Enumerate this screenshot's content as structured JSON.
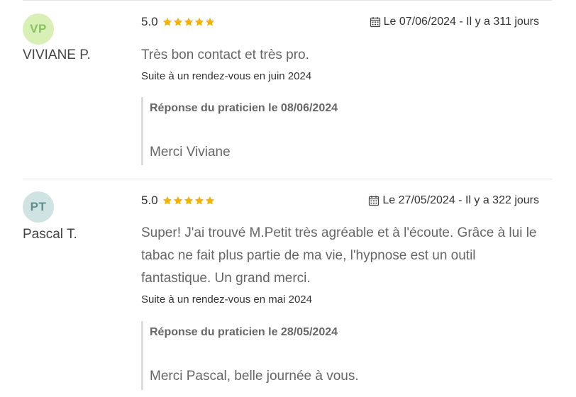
{
  "colors": {
    "star": "#f5b301",
    "avatar_vp_bg": "#d8f0b5",
    "avatar_vp_text": "#8cc063",
    "avatar_pt_bg": "#cfe3e3",
    "avatar_pt_text": "#5f8f8f"
  },
  "icons": {
    "star": "star-icon",
    "calendar": "calendar-icon"
  },
  "reviews": [
    {
      "initials": "VP",
      "author": "VIVIANE P.",
      "rating_value": "5.0",
      "stars": 5,
      "date": "Le 07/06/2024 - Il y a 311 jours",
      "comment": "Très bon contact et très pro.",
      "visit": "Suite à un rendez-vous en juin 2024",
      "response_title": "Réponse du praticien le 08/06/2024",
      "response_text": "Merci Viviane"
    },
    {
      "initials": "PT",
      "author": "Pascal T.",
      "rating_value": "5.0",
      "stars": 5,
      "date": "Le 27/05/2024 - Il y a 322 jours",
      "comment": "Super! J'ai trouvé M.Petit très agréable et à l'écoute. Grâce à lui le tabac ne fait plus partie de ma vie, l'hypnose est un outil fantastique. Un grand merci.",
      "visit": "Suite à un rendez-vous en mai 2024",
      "response_title": "Réponse du praticien le 28/05/2024",
      "response_text": "Merci Pascal, belle journée à vous."
    }
  ]
}
